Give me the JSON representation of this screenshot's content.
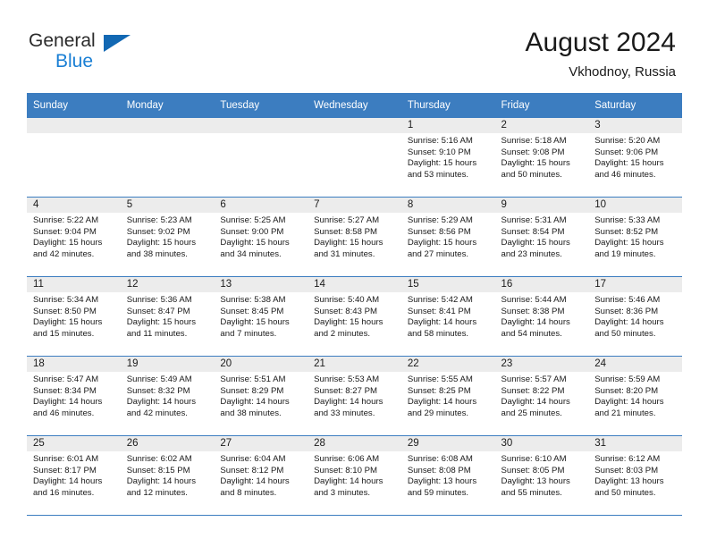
{
  "logo": {
    "word_top": "General",
    "word_bottom": "Blue",
    "triangle_color": "#1268b3",
    "blue_color": "#1a7fd4"
  },
  "header": {
    "title": "August 2024",
    "subtitle": "Vkhodnoy, Russia"
  },
  "theme": {
    "header_blue": "#3c7dc0",
    "daynum_band": "#ececec",
    "text": "#1a1a1a"
  },
  "weekday_headers": [
    "Sunday",
    "Monday",
    "Tuesday",
    "Wednesday",
    "Thursday",
    "Friday",
    "Saturday"
  ],
  "labels": {
    "sunrise": "Sunrise:",
    "sunset": "Sunset:",
    "daylight": "Daylight:"
  },
  "weeks": [
    [
      {
        "day": "",
        "sunrise": "",
        "sunset": "",
        "daylight_line1": "",
        "daylight_line2": ""
      },
      {
        "day": "",
        "sunrise": "",
        "sunset": "",
        "daylight_line1": "",
        "daylight_line2": ""
      },
      {
        "day": "",
        "sunrise": "",
        "sunset": "",
        "daylight_line1": "",
        "daylight_line2": ""
      },
      {
        "day": "",
        "sunrise": "",
        "sunset": "",
        "daylight_line1": "",
        "daylight_line2": ""
      },
      {
        "day": "1",
        "sunrise": "Sunrise: 5:16 AM",
        "sunset": "Sunset: 9:10 PM",
        "daylight_line1": "Daylight: 15 hours",
        "daylight_line2": "and 53 minutes."
      },
      {
        "day": "2",
        "sunrise": "Sunrise: 5:18 AM",
        "sunset": "Sunset: 9:08 PM",
        "daylight_line1": "Daylight: 15 hours",
        "daylight_line2": "and 50 minutes."
      },
      {
        "day": "3",
        "sunrise": "Sunrise: 5:20 AM",
        "sunset": "Sunset: 9:06 PM",
        "daylight_line1": "Daylight: 15 hours",
        "daylight_line2": "and 46 minutes."
      }
    ],
    [
      {
        "day": "4",
        "sunrise": "Sunrise: 5:22 AM",
        "sunset": "Sunset: 9:04 PM",
        "daylight_line1": "Daylight: 15 hours",
        "daylight_line2": "and 42 minutes."
      },
      {
        "day": "5",
        "sunrise": "Sunrise: 5:23 AM",
        "sunset": "Sunset: 9:02 PM",
        "daylight_line1": "Daylight: 15 hours",
        "daylight_line2": "and 38 minutes."
      },
      {
        "day": "6",
        "sunrise": "Sunrise: 5:25 AM",
        "sunset": "Sunset: 9:00 PM",
        "daylight_line1": "Daylight: 15 hours",
        "daylight_line2": "and 34 minutes."
      },
      {
        "day": "7",
        "sunrise": "Sunrise: 5:27 AM",
        "sunset": "Sunset: 8:58 PM",
        "daylight_line1": "Daylight: 15 hours",
        "daylight_line2": "and 31 minutes."
      },
      {
        "day": "8",
        "sunrise": "Sunrise: 5:29 AM",
        "sunset": "Sunset: 8:56 PM",
        "daylight_line1": "Daylight: 15 hours",
        "daylight_line2": "and 27 minutes."
      },
      {
        "day": "9",
        "sunrise": "Sunrise: 5:31 AM",
        "sunset": "Sunset: 8:54 PM",
        "daylight_line1": "Daylight: 15 hours",
        "daylight_line2": "and 23 minutes."
      },
      {
        "day": "10",
        "sunrise": "Sunrise: 5:33 AM",
        "sunset": "Sunset: 8:52 PM",
        "daylight_line1": "Daylight: 15 hours",
        "daylight_line2": "and 19 minutes."
      }
    ],
    [
      {
        "day": "11",
        "sunrise": "Sunrise: 5:34 AM",
        "sunset": "Sunset: 8:50 PM",
        "daylight_line1": "Daylight: 15 hours",
        "daylight_line2": "and 15 minutes."
      },
      {
        "day": "12",
        "sunrise": "Sunrise: 5:36 AM",
        "sunset": "Sunset: 8:47 PM",
        "daylight_line1": "Daylight: 15 hours",
        "daylight_line2": "and 11 minutes."
      },
      {
        "day": "13",
        "sunrise": "Sunrise: 5:38 AM",
        "sunset": "Sunset: 8:45 PM",
        "daylight_line1": "Daylight: 15 hours",
        "daylight_line2": "and 7 minutes."
      },
      {
        "day": "14",
        "sunrise": "Sunrise: 5:40 AM",
        "sunset": "Sunset: 8:43 PM",
        "daylight_line1": "Daylight: 15 hours",
        "daylight_line2": "and 2 minutes."
      },
      {
        "day": "15",
        "sunrise": "Sunrise: 5:42 AM",
        "sunset": "Sunset: 8:41 PM",
        "daylight_line1": "Daylight: 14 hours",
        "daylight_line2": "and 58 minutes."
      },
      {
        "day": "16",
        "sunrise": "Sunrise: 5:44 AM",
        "sunset": "Sunset: 8:38 PM",
        "daylight_line1": "Daylight: 14 hours",
        "daylight_line2": "and 54 minutes."
      },
      {
        "day": "17",
        "sunrise": "Sunrise: 5:46 AM",
        "sunset": "Sunset: 8:36 PM",
        "daylight_line1": "Daylight: 14 hours",
        "daylight_line2": "and 50 minutes."
      }
    ],
    [
      {
        "day": "18",
        "sunrise": "Sunrise: 5:47 AM",
        "sunset": "Sunset: 8:34 PM",
        "daylight_line1": "Daylight: 14 hours",
        "daylight_line2": "and 46 minutes."
      },
      {
        "day": "19",
        "sunrise": "Sunrise: 5:49 AM",
        "sunset": "Sunset: 8:32 PM",
        "daylight_line1": "Daylight: 14 hours",
        "daylight_line2": "and 42 minutes."
      },
      {
        "day": "20",
        "sunrise": "Sunrise: 5:51 AM",
        "sunset": "Sunset: 8:29 PM",
        "daylight_line1": "Daylight: 14 hours",
        "daylight_line2": "and 38 minutes."
      },
      {
        "day": "21",
        "sunrise": "Sunrise: 5:53 AM",
        "sunset": "Sunset: 8:27 PM",
        "daylight_line1": "Daylight: 14 hours",
        "daylight_line2": "and 33 minutes."
      },
      {
        "day": "22",
        "sunrise": "Sunrise: 5:55 AM",
        "sunset": "Sunset: 8:25 PM",
        "daylight_line1": "Daylight: 14 hours",
        "daylight_line2": "and 29 minutes."
      },
      {
        "day": "23",
        "sunrise": "Sunrise: 5:57 AM",
        "sunset": "Sunset: 8:22 PM",
        "daylight_line1": "Daylight: 14 hours",
        "daylight_line2": "and 25 minutes."
      },
      {
        "day": "24",
        "sunrise": "Sunrise: 5:59 AM",
        "sunset": "Sunset: 8:20 PM",
        "daylight_line1": "Daylight: 14 hours",
        "daylight_line2": "and 21 minutes."
      }
    ],
    [
      {
        "day": "25",
        "sunrise": "Sunrise: 6:01 AM",
        "sunset": "Sunset: 8:17 PM",
        "daylight_line1": "Daylight: 14 hours",
        "daylight_line2": "and 16 minutes."
      },
      {
        "day": "26",
        "sunrise": "Sunrise: 6:02 AM",
        "sunset": "Sunset: 8:15 PM",
        "daylight_line1": "Daylight: 14 hours",
        "daylight_line2": "and 12 minutes."
      },
      {
        "day": "27",
        "sunrise": "Sunrise: 6:04 AM",
        "sunset": "Sunset: 8:12 PM",
        "daylight_line1": "Daylight: 14 hours",
        "daylight_line2": "and 8 minutes."
      },
      {
        "day": "28",
        "sunrise": "Sunrise: 6:06 AM",
        "sunset": "Sunset: 8:10 PM",
        "daylight_line1": "Daylight: 14 hours",
        "daylight_line2": "and 3 minutes."
      },
      {
        "day": "29",
        "sunrise": "Sunrise: 6:08 AM",
        "sunset": "Sunset: 8:08 PM",
        "daylight_line1": "Daylight: 13 hours",
        "daylight_line2": "and 59 minutes."
      },
      {
        "day": "30",
        "sunrise": "Sunrise: 6:10 AM",
        "sunset": "Sunset: 8:05 PM",
        "daylight_line1": "Daylight: 13 hours",
        "daylight_line2": "and 55 minutes."
      },
      {
        "day": "31",
        "sunrise": "Sunrise: 6:12 AM",
        "sunset": "Sunset: 8:03 PM",
        "daylight_line1": "Daylight: 13 hours",
        "daylight_line2": "and 50 minutes."
      }
    ]
  ]
}
